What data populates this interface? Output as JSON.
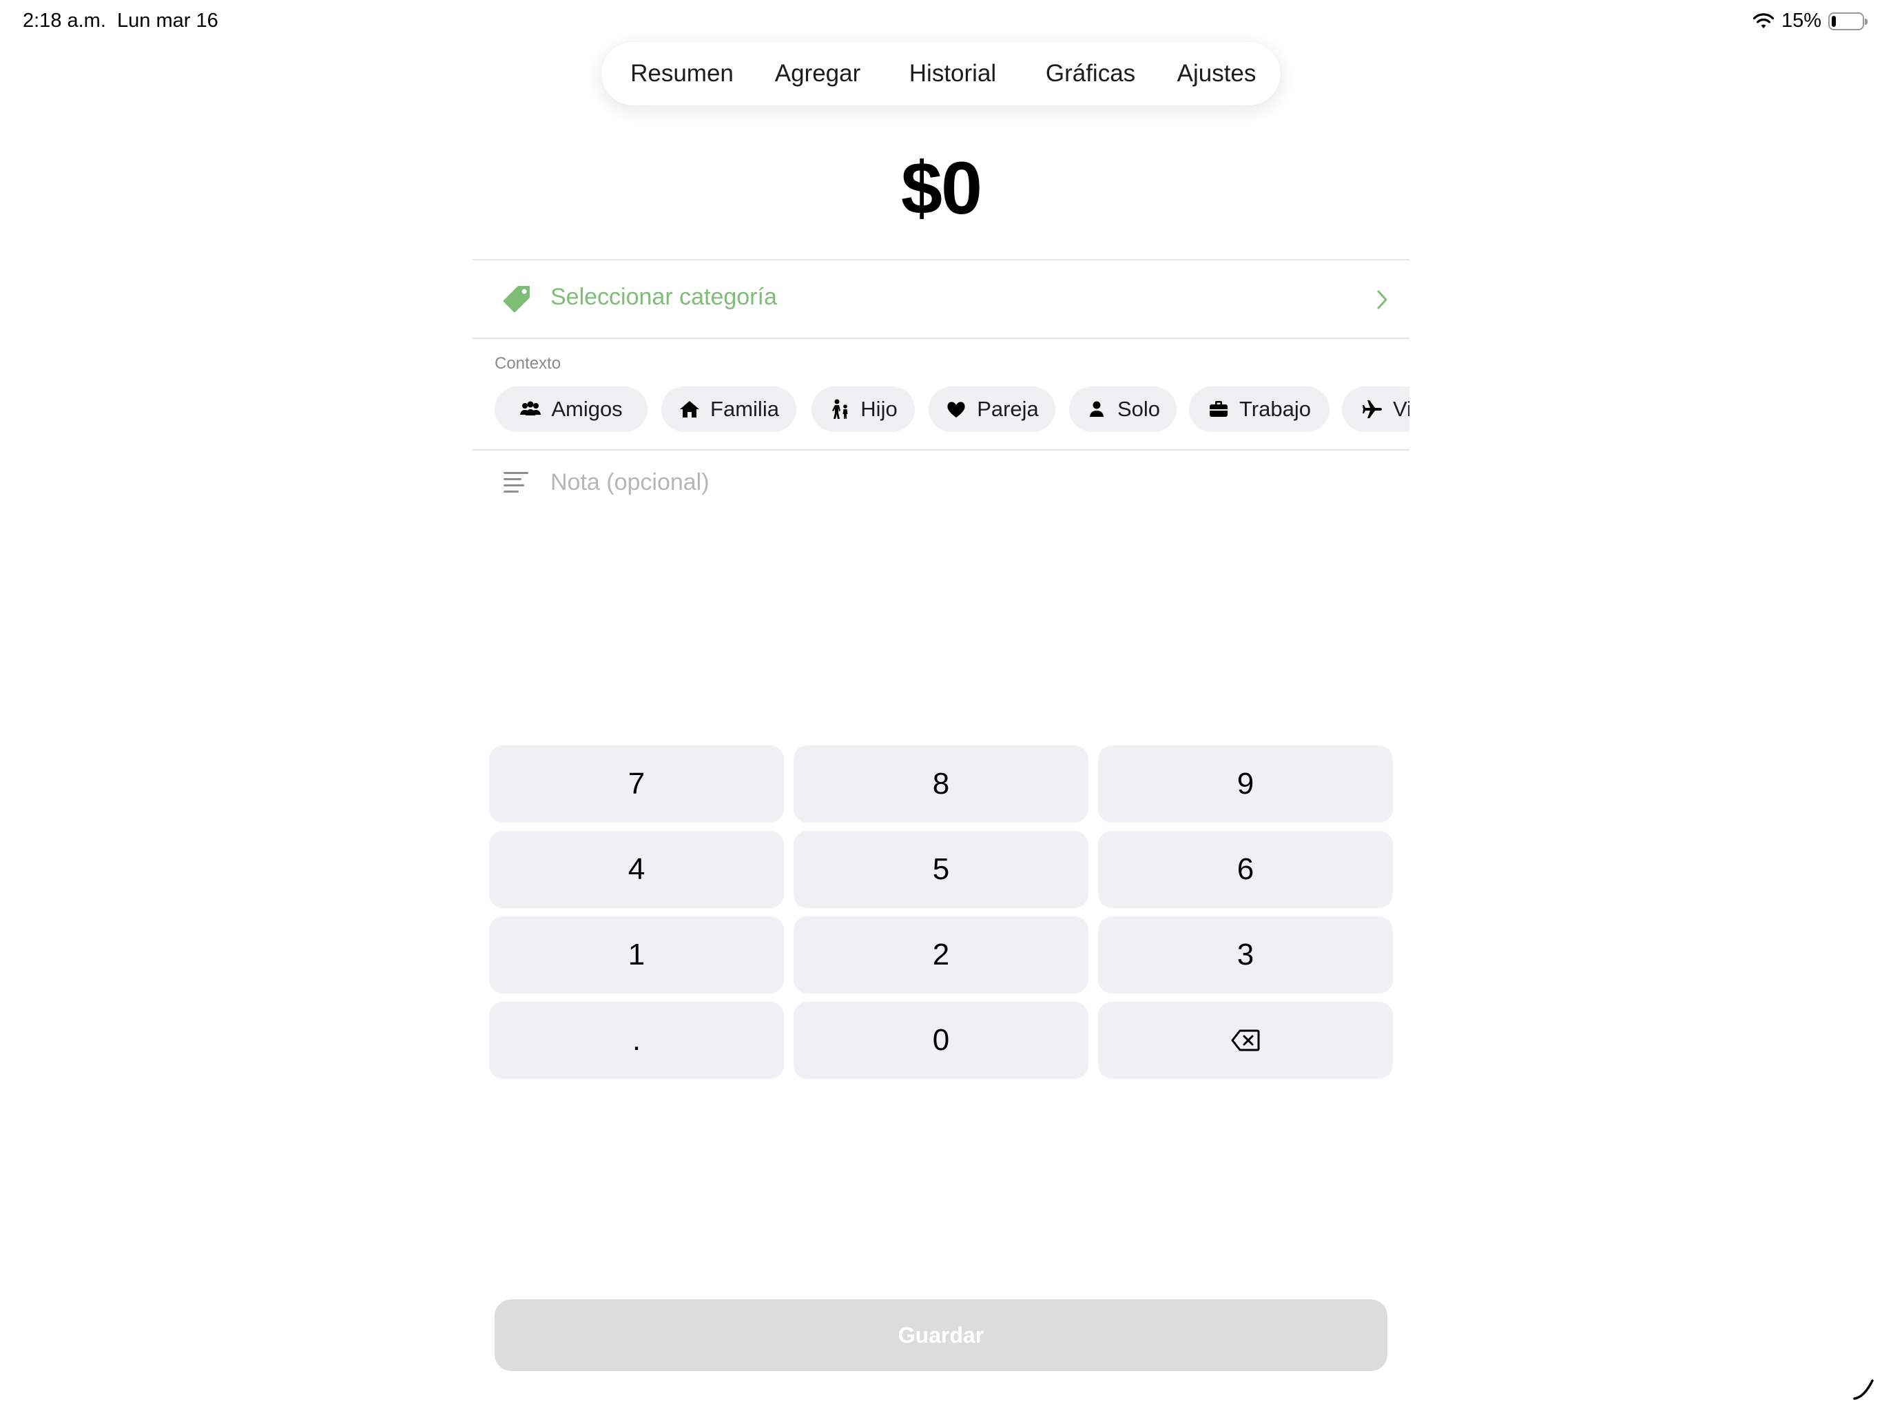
{
  "status_bar": {
    "time": "2:18 a.m.",
    "date": "Lun mar 16",
    "battery": "15%",
    "battery_level": 0.15
  },
  "tabs": [
    {
      "label": "Resumen",
      "active": false
    },
    {
      "label": "Agregar",
      "active": true
    },
    {
      "label": "Historial",
      "active": false
    },
    {
      "label": "Gráficas",
      "active": false
    },
    {
      "label": "Ajustes",
      "active": false
    }
  ],
  "amount": "$0",
  "category": {
    "placeholder": "Seleccionar categoría",
    "icon": "tag-icon"
  },
  "context": {
    "label": "Contexto",
    "chips": [
      {
        "label": "Amigos",
        "icon": "people-icon"
      },
      {
        "label": "Familia",
        "icon": "house-icon"
      },
      {
        "label": "Hijo",
        "icon": "child-icon"
      },
      {
        "label": "Pareja",
        "icon": "heart-icon"
      },
      {
        "label": "Solo",
        "icon": "person-icon"
      },
      {
        "label": "Trabajo",
        "icon": "briefcase-icon"
      },
      {
        "label": "Vi",
        "icon": "airplane-icon"
      }
    ]
  },
  "note": {
    "placeholder": "Nota (opcional)"
  },
  "keypad": {
    "keys": [
      "7",
      "8",
      "9",
      "4",
      "5",
      "6",
      "1",
      "2",
      "3",
      ".",
      "0",
      "⌫"
    ]
  },
  "save_button": "Guardar",
  "colors": {
    "accent_green": "#2e9a2a",
    "category_green": "#7dbd75",
    "key_background": "#f0f0f4",
    "save_disabled": "#dcdcdc"
  }
}
